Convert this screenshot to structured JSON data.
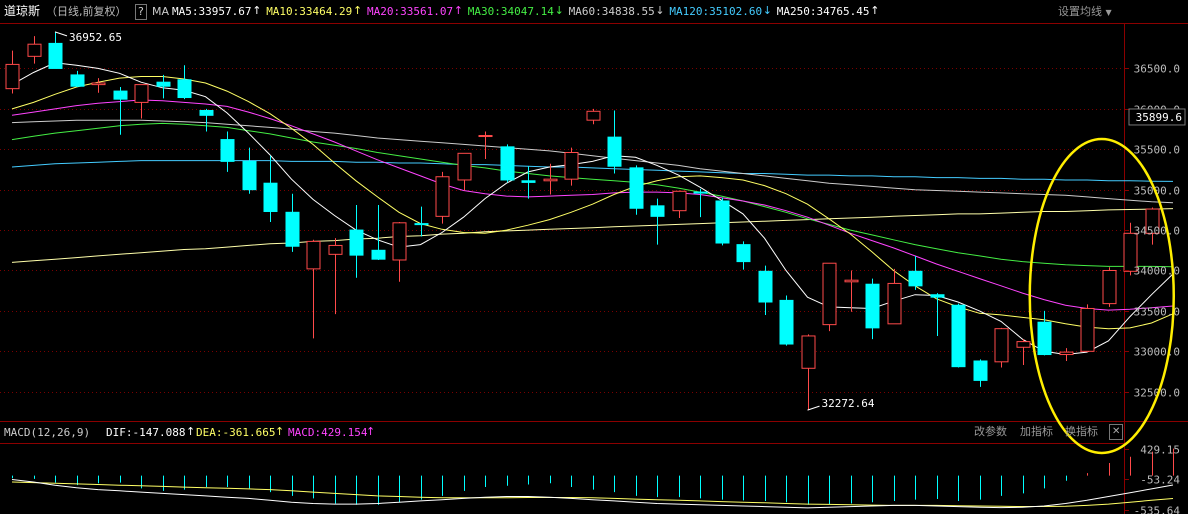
{
  "header": {
    "symbol": "道琼斯",
    "period": "（日线,前复权）",
    "help_label": "?",
    "ma_label": "MA",
    "ma_items": [
      {
        "text": "MA5:33957.67",
        "color": "#ffffff",
        "arrow": "up"
      },
      {
        "text": "MA10:33464.29",
        "color": "#ffff66",
        "arrow": "up"
      },
      {
        "text": "MA20:33561.07",
        "color": "#ff44ff",
        "arrow": "up"
      },
      {
        "text": "MA30:34047.14",
        "color": "#44ee44",
        "arrow": "down"
      },
      {
        "text": "MA60:34838.55",
        "color": "#cccccc",
        "arrow": "down"
      },
      {
        "text": "MA120:35102.60",
        "color": "#44ccff",
        "arrow": "down"
      },
      {
        "text": "MA250:34765.45",
        "color": "#ffffff",
        "arrow": "up"
      }
    ],
    "settings_label": "设置均线"
  },
  "macd_header": {
    "title": "MACD(12,26,9)",
    "dif": "DIF:-147.088",
    "dea": "DEA:-361.665",
    "macd": "MACD:429.154",
    "buttons": [
      "改参数",
      "加指标",
      "换指标"
    ],
    "close_label": "✕"
  },
  "colors": {
    "up": "#ff4a4a",
    "down": "#00ffff",
    "grid": "#7a0000",
    "ma5": "#ffffff",
    "ma10": "#ffff66",
    "ma20": "#ff44ff",
    "ma30": "#44ee44",
    "ma60": "#cccccc",
    "ma120": "#44ccff",
    "ma250": "#ffffaa",
    "dif": "#ffffff",
    "dea": "#ffff66",
    "highlight": "#ffee00"
  },
  "chart_data": [
    {
      "type": "candlestick",
      "y_ticks": [
        "36500.0",
        "36000.0",
        "35500.0",
        "35000.0",
        "34500.0",
        "34000.0",
        "33500.0",
        "33000.0",
        "32500.0"
      ],
      "y_tick_values": [
        36500,
        36000,
        35500,
        35000,
        34500,
        34000,
        33500,
        33000,
        32500
      ],
      "ylim": [
        32150,
        37050
      ],
      "current_price": "35899.6",
      "current_price_value": 35899.6,
      "high_annotation": {
        "text": "36952.65",
        "value": 36952.65
      },
      "low_annotation": {
        "text": "32272.64",
        "value": 32272.64
      },
      "candles": [
        {
          "o": 36250,
          "h": 36720,
          "l": 36190,
          "c": 36550
        },
        {
          "o": 36650,
          "h": 36900,
          "l": 36560,
          "c": 36800
        },
        {
          "o": 36810,
          "h": 36952.65,
          "l": 36500,
          "c": 36500
        },
        {
          "o": 36420,
          "h": 36470,
          "l": 36270,
          "c": 36280
        },
        {
          "o": 36300,
          "h": 36380,
          "l": 36200,
          "c": 36320
        },
        {
          "o": 36220,
          "h": 36270,
          "l": 35680,
          "c": 36120
        },
        {
          "o": 36080,
          "h": 36280,
          "l": 35880,
          "c": 36300
        },
        {
          "o": 36330,
          "h": 36420,
          "l": 36130,
          "c": 36280
        },
        {
          "o": 36360,
          "h": 36540,
          "l": 36120,
          "c": 36140
        },
        {
          "o": 35980,
          "h": 36000,
          "l": 35720,
          "c": 35920
        },
        {
          "o": 35620,
          "h": 35720,
          "l": 35220,
          "c": 35350
        },
        {
          "o": 35350,
          "h": 35520,
          "l": 34950,
          "c": 35000
        },
        {
          "o": 35080,
          "h": 35420,
          "l": 34600,
          "c": 34730
        },
        {
          "o": 34720,
          "h": 34950,
          "l": 34230,
          "c": 34300
        },
        {
          "o": 34020,
          "h": 34380,
          "l": 33160,
          "c": 34360
        },
        {
          "o": 34200,
          "h": 34400,
          "l": 33460,
          "c": 34310
        },
        {
          "o": 34500,
          "h": 34810,
          "l": 33910,
          "c": 34190
        },
        {
          "o": 34250,
          "h": 34810,
          "l": 34130,
          "c": 34140
        },
        {
          "o": 34130,
          "h": 34600,
          "l": 33860,
          "c": 34590
        },
        {
          "o": 34580,
          "h": 34790,
          "l": 34420,
          "c": 34570
        },
        {
          "o": 34670,
          "h": 35220,
          "l": 34580,
          "c": 35160
        },
        {
          "o": 35120,
          "h": 35450,
          "l": 34990,
          "c": 35450
        },
        {
          "o": 35660,
          "h": 35720,
          "l": 35380,
          "c": 35670
        },
        {
          "o": 35530,
          "h": 35560,
          "l": 35090,
          "c": 35120
        },
        {
          "o": 35110,
          "h": 35290,
          "l": 34890,
          "c": 35090
        },
        {
          "o": 35110,
          "h": 35320,
          "l": 34940,
          "c": 35130
        },
        {
          "o": 35130,
          "h": 35520,
          "l": 35050,
          "c": 35460
        },
        {
          "o": 35860,
          "h": 36000,
          "l": 35810,
          "c": 35970
        },
        {
          "o": 35650,
          "h": 35980,
          "l": 35200,
          "c": 35290
        },
        {
          "o": 35270,
          "h": 35300,
          "l": 34690,
          "c": 34770
        },
        {
          "o": 34800,
          "h": 34890,
          "l": 34320,
          "c": 34670
        },
        {
          "o": 34740,
          "h": 34990,
          "l": 34650,
          "c": 34980
        },
        {
          "o": 34970,
          "h": 35010,
          "l": 34660,
          "c": 34960
        },
        {
          "o": 34860,
          "h": 34900,
          "l": 34310,
          "c": 34340
        },
        {
          "o": 34320,
          "h": 34360,
          "l": 34010,
          "c": 34110
        },
        {
          "o": 33990,
          "h": 34060,
          "l": 33450,
          "c": 33610
        },
        {
          "o": 33630,
          "h": 33690,
          "l": 33070,
          "c": 33090
        },
        {
          "o": 32790,
          "h": 33210,
          "l": 32272.64,
          "c": 33190
        },
        {
          "o": 33330,
          "h": 34090,
          "l": 33250,
          "c": 34090
        },
        {
          "o": 33860,
          "h": 34000,
          "l": 33490,
          "c": 33880
        },
        {
          "o": 33830,
          "h": 33900,
          "l": 33150,
          "c": 33290
        },
        {
          "o": 33340,
          "h": 34020,
          "l": 33340,
          "c": 33840
        },
        {
          "o": 33990,
          "h": 34180,
          "l": 33760,
          "c": 33810
        },
        {
          "o": 33700,
          "h": 33720,
          "l": 33190,
          "c": 33670
        },
        {
          "o": 33570,
          "h": 33590,
          "l": 32800,
          "c": 32810
        },
        {
          "o": 32880,
          "h": 32900,
          "l": 32560,
          "c": 32640
        },
        {
          "o": 32870,
          "h": 33290,
          "l": 32800,
          "c": 33280
        },
        {
          "o": 33050,
          "h": 33150,
          "l": 32830,
          "c": 33120
        },
        {
          "o": 33360,
          "h": 33500,
          "l": 32950,
          "c": 32960
        },
        {
          "o": 32960,
          "h": 33040,
          "l": 32880,
          "c": 32990
        },
        {
          "o": 33000,
          "h": 33580,
          "l": 32990,
          "c": 33530
        },
        {
          "o": 33590,
          "h": 34040,
          "l": 33550,
          "c": 34000
        },
        {
          "o": 33990,
          "h": 34590,
          "l": 33940,
          "c": 34460
        },
        {
          "o": 34460,
          "h": 34780,
          "l": 34320,
          "c": 34760
        }
      ],
      "ma_lines": {
        "ma5": [
          36300,
          36450,
          36570,
          36540,
          36500,
          36440,
          36330,
          36260,
          36230,
          36150,
          35950,
          35700,
          35430,
          35130,
          34880,
          34680,
          34500,
          34380,
          34290,
          34320,
          34470,
          34660,
          34890,
          35080,
          35220,
          35280,
          35310,
          35350,
          35420,
          35400,
          35300,
          35180,
          35030,
          34870,
          34700,
          34400,
          34000,
          33670,
          33550,
          33540,
          33530,
          33620,
          33700,
          33690,
          33610,
          33500,
          33370,
          33150,
          33000,
          32960,
          32990,
          33130,
          33430,
          33700,
          33957.67
        ],
        "ma10": [
          36000,
          36080,
          36180,
          36270,
          36330,
          36380,
          36400,
          36400,
          36370,
          36320,
          36220,
          36090,
          35940,
          35760,
          35560,
          35330,
          35110,
          34910,
          34720,
          34580,
          34510,
          34470,
          34460,
          34500,
          34560,
          34630,
          34720,
          34820,
          34940,
          35040,
          35110,
          35160,
          35170,
          35150,
          35120,
          35050,
          34950,
          34820,
          34640,
          34450,
          34230,
          34000,
          33810,
          33650,
          33550,
          33470,
          33450,
          33420,
          33390,
          33340,
          33300,
          33280,
          33290,
          33350,
          33464.29
        ],
        "ma20": [
          35920,
          35960,
          36000,
          36040,
          36070,
          36090,
          36110,
          36100,
          36080,
          36060,
          36030,
          35960,
          35880,
          35790,
          35690,
          35590,
          35480,
          35370,
          35270,
          35170,
          35070,
          34990,
          34950,
          34920,
          34910,
          34920,
          34930,
          34940,
          34960,
          34970,
          34970,
          34960,
          34940,
          34900,
          34860,
          34810,
          34740,
          34660,
          34560,
          34460,
          34370,
          34280,
          34180,
          34080,
          33990,
          33900,
          33810,
          33720,
          33640,
          33570,
          33530,
          33510,
          33520,
          33540,
          33561.07
        ],
        "ma30": [
          35620,
          35660,
          35700,
          35730,
          35760,
          35790,
          35810,
          35820,
          35810,
          35790,
          35770,
          35730,
          35690,
          35640,
          35590,
          35550,
          35510,
          35460,
          35420,
          35380,
          35340,
          35300,
          35270,
          35230,
          35200,
          35170,
          35150,
          35130,
          35110,
          35090,
          35060,
          35020,
          34970,
          34920,
          34860,
          34790,
          34720,
          34640,
          34570,
          34500,
          34440,
          34380,
          34320,
          34270,
          34220,
          34180,
          34140,
          34110,
          34090,
          34070,
          34060,
          34050,
          34050,
          34050,
          34047.14
        ],
        "ma60": [
          35830,
          35840,
          35850,
          35860,
          35860,
          35860,
          35860,
          35850,
          35840,
          35830,
          35810,
          35790,
          35770,
          35750,
          35720,
          35700,
          35670,
          35640,
          35620,
          35600,
          35580,
          35560,
          35540,
          35520,
          35500,
          35480,
          35450,
          35420,
          35390,
          35360,
          35330,
          35300,
          35260,
          35230,
          35200,
          35170,
          35140,
          35110,
          35080,
          35060,
          35040,
          35020,
          35000,
          34990,
          34980,
          34970,
          34960,
          34950,
          34940,
          34930,
          34910,
          34890,
          34870,
          34850,
          34838.55
        ],
        "ma120": [
          35280,
          35300,
          35320,
          35330,
          35340,
          35350,
          35360,
          35360,
          35360,
          35360,
          35360,
          35360,
          35360,
          35350,
          35350,
          35350,
          35340,
          35340,
          35330,
          35330,
          35320,
          35310,
          35310,
          35300,
          35290,
          35280,
          35280,
          35270,
          35260,
          35250,
          35240,
          35230,
          35220,
          35210,
          35200,
          35200,
          35190,
          35180,
          35180,
          35170,
          35170,
          35160,
          35160,
          35150,
          35150,
          35140,
          35140,
          35130,
          35130,
          35120,
          35120,
          35110,
          35110,
          35105,
          35102.6
        ],
        "ma250": [
          34100,
          34120,
          34140,
          34160,
          34180,
          34200,
          34220,
          34240,
          34260,
          34270,
          34290,
          34310,
          34330,
          34340,
          34360,
          34370,
          34390,
          34400,
          34420,
          34430,
          34450,
          34460,
          34480,
          34490,
          34500,
          34510,
          34520,
          34530,
          34540,
          34550,
          34560,
          34570,
          34580,
          34590,
          34600,
          34610,
          34620,
          34630,
          34640,
          34650,
          34660,
          34670,
          34680,
          34690,
          34700,
          34700,
          34710,
          34720,
          34730,
          34730,
          34740,
          34750,
          34755,
          34760,
          34765.45
        ]
      }
    },
    {
      "type": "macd",
      "y_ticks": [
        "429.15",
        "-53.24",
        "-535.64"
      ],
      "y_tick_values": [
        429.15,
        -53.24,
        -535.64
      ],
      "ylim": [
        -575,
        470
      ],
      "hist": [
        -40,
        -50,
        -110,
        -150,
        -120,
        -110,
        -200,
        -240,
        -220,
        -180,
        -180,
        -200,
        -260,
        -320,
        -360,
        -440,
        -460,
        -460,
        -420,
        -380,
        -320,
        -240,
        -180,
        -160,
        -140,
        -120,
        -180,
        -220,
        -260,
        -320,
        -340,
        -340,
        -360,
        -380,
        -390,
        -400,
        -420,
        -460,
        -450,
        -440,
        -420,
        -400,
        -380,
        -370,
        -400,
        -380,
        -320,
        -280,
        -200,
        -80,
        40,
        200,
        300,
        380,
        429.154
      ],
      "dif": [
        -60,
        -100,
        -150,
        -190,
        -220,
        -240,
        -260,
        -280,
        -300,
        -320,
        -340,
        -360,
        -390,
        -420,
        -440,
        -450,
        -450,
        -440,
        -420,
        -400,
        -380,
        -360,
        -340,
        -330,
        -330,
        -340,
        -360,
        -380,
        -400,
        -420,
        -440,
        -450,
        -460,
        -470,
        -480,
        -490,
        -500,
        -510,
        -500,
        -490,
        -480,
        -470,
        -470,
        -480,
        -490,
        -500,
        -505,
        -500,
        -480,
        -440,
        -390,
        -330,
        -270,
        -210,
        -147.088
      ],
      "dea": [
        -100,
        -110,
        -120,
        -130,
        -140,
        -150,
        -160,
        -170,
        -180,
        -190,
        -200,
        -210,
        -220,
        -240,
        -260,
        -280,
        -300,
        -320,
        -330,
        -340,
        -350,
        -350,
        -350,
        -350,
        -345,
        -345,
        -345,
        -350,
        -360,
        -370,
        -380,
        -390,
        -400,
        -410,
        -420,
        -430,
        -440,
        -450,
        -455,
        -460,
        -465,
        -470,
        -470,
        -470,
        -475,
        -480,
        -485,
        -488,
        -488,
        -484,
        -470,
        -450,
        -420,
        -390,
        -361.665
      ]
    }
  ]
}
